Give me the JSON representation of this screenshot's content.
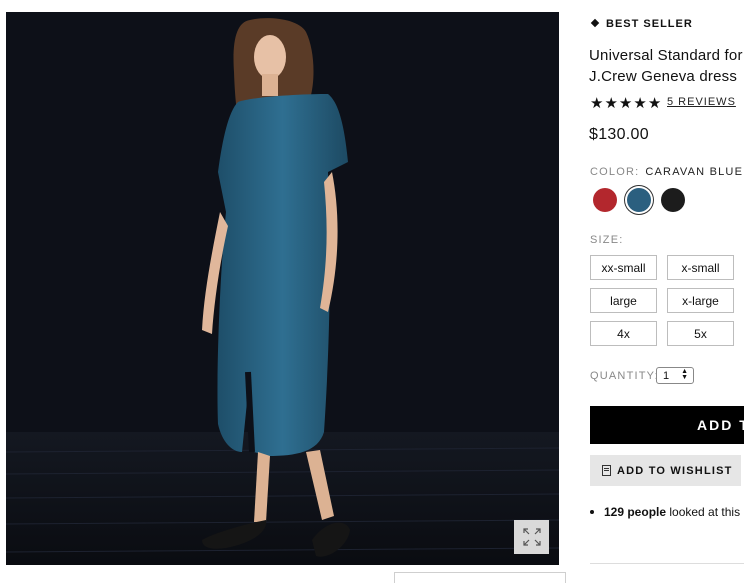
{
  "product": {
    "badge": "BEST SELLER",
    "title": "Universal Standard for J.Crew Geneva dress",
    "rating_stars": 5,
    "reviews_label": "5 REVIEWS",
    "price": "$130.00"
  },
  "color": {
    "label": "COLOR:",
    "selected": "CARAVAN BLUE",
    "swatches": [
      {
        "name": "red",
        "hex": "#b3272d"
      },
      {
        "name": "caravan blue",
        "hex": "#2b5f7f"
      },
      {
        "name": "black",
        "hex": "#1c1c1c"
      }
    ]
  },
  "size": {
    "label": "SIZE:",
    "options": [
      "xx-small",
      "x-small",
      "large",
      "x-large",
      "4x",
      "5x"
    ]
  },
  "quantity": {
    "label": "QUANTITY:",
    "value": "1"
  },
  "actions": {
    "add_to_bag": "ADD TO BAG",
    "wishlist": "ADD TO WISHLIST"
  },
  "social_proof": {
    "count": "129 people",
    "text": " looked at this"
  },
  "icons": {
    "expand": "expand-arrows-icon",
    "wishlist": "clipboard-icon",
    "star": "star-icon"
  }
}
